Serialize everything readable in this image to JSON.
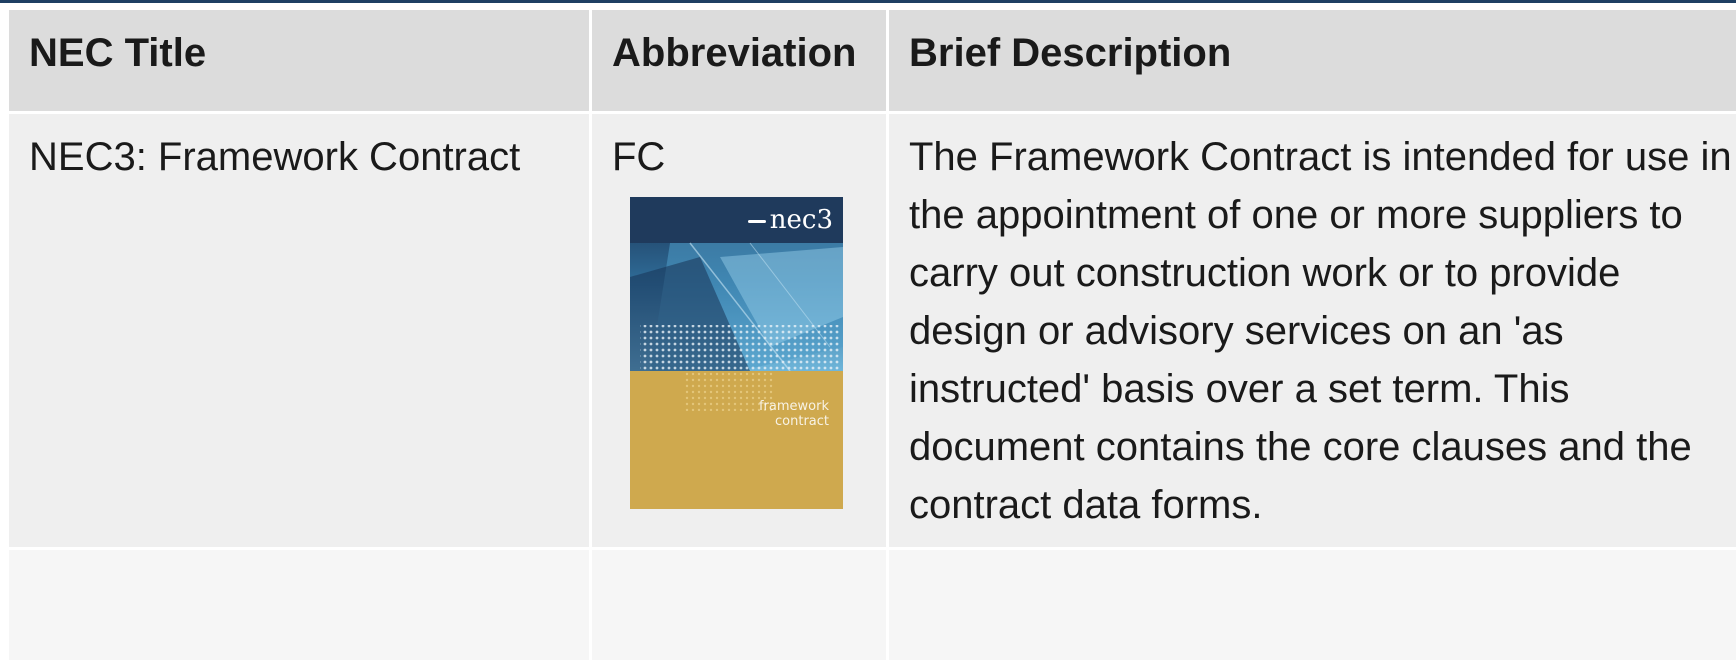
{
  "table": {
    "headers": [
      "NEC Title",
      "Abbreviation",
      "Brief Description"
    ],
    "rows": [
      {
        "title": "NEC3: Framework Contract",
        "abbreviation": "FC",
        "description": "The Framework Contract is intended for use in the appointment of one or more suppliers to carry out construction work or to provide design or advisory services on an 'as instructed' basis over a set term. This document contains the core clauses and the contract data forms."
      }
    ]
  },
  "cover": {
    "logo": "nec3",
    "label": "framework contract",
    "colors": {
      "top": "#1f3a5c",
      "bottom": "#cfa94e"
    }
  },
  "colors": {
    "header_bg": "#dcdcdc",
    "row_bg": "#efefef",
    "empty_row_bg": "#f6f6f6",
    "top_rule": "#1f3f63"
  }
}
